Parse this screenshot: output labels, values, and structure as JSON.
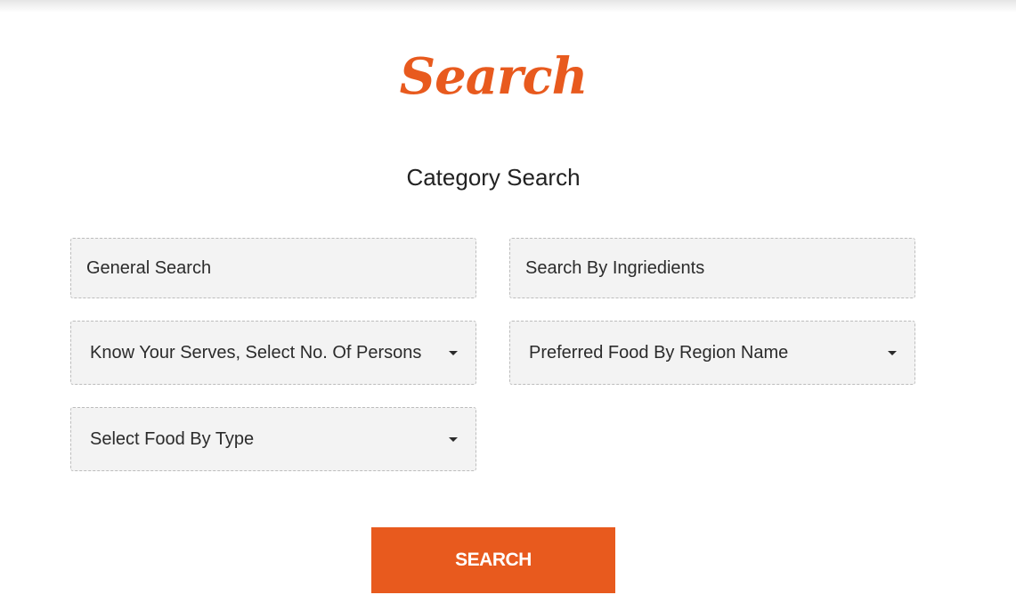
{
  "header": {
    "script_title": "Search"
  },
  "form": {
    "title": "Category Search",
    "general_search": {
      "placeholder": "General Search"
    },
    "ingredients_search": {
      "placeholder": "Search By Ingriedients"
    },
    "serves_select": {
      "value": "Know Your Serves, Select No. Of Persons"
    },
    "region_select": {
      "value": "Preferred Food By Region Name"
    },
    "type_select": {
      "value": "Select Food By Type"
    },
    "submit_label": "SEARCH"
  },
  "colors": {
    "accent": "#e85a1e",
    "field_background": "#f3f3f3",
    "field_border": "#bdbdbd",
    "text": "#222222"
  },
  "icons": {
    "select_caret": "caret-down-icon"
  }
}
